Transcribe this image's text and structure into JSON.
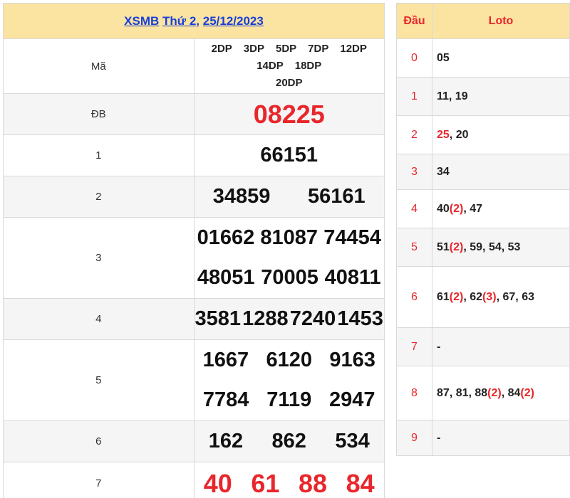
{
  "header": {
    "brand": "XSMB",
    "day": "Thứ 2",
    "separator": ",",
    "date": "25/12/2023"
  },
  "ma": {
    "label": "Mã",
    "codes": [
      "2DP",
      "3DP",
      "5DP",
      "7DP",
      "12DP",
      "14DP",
      "18DP",
      "20DP"
    ]
  },
  "prizes": [
    {
      "label": "ĐB",
      "numbers": [
        "08225"
      ]
    },
    {
      "label": "1",
      "numbers": [
        "66151"
      ]
    },
    {
      "label": "2",
      "numbers": [
        "34859",
        "56161"
      ]
    },
    {
      "label": "3",
      "numbers": [
        "01662",
        "81087",
        "74454",
        "48051",
        "70005",
        "40811"
      ]
    },
    {
      "label": "4",
      "numbers": [
        "3581",
        "1288",
        "7240",
        "1453"
      ]
    },
    {
      "label": "5",
      "numbers": [
        "1667",
        "6120",
        "9163",
        "7784",
        "7119",
        "2947"
      ]
    },
    {
      "label": "6",
      "numbers": [
        "162",
        "862",
        "534"
      ]
    },
    {
      "label": "7",
      "numbers": [
        "40",
        "61",
        "88",
        "84"
      ]
    }
  ],
  "loto": {
    "col_dau": "Đầu",
    "col_loto": "Loto",
    "rows": [
      {
        "dau": "0",
        "parts": [
          [
            "05",
            false
          ]
        ]
      },
      {
        "dau": "1",
        "parts": [
          [
            "11, 19",
            false
          ]
        ]
      },
      {
        "dau": "2",
        "parts": [
          [
            "25",
            true
          ],
          [
            ", 20",
            false
          ]
        ]
      },
      {
        "dau": "3",
        "parts": [
          [
            "34",
            false
          ]
        ]
      },
      {
        "dau": "4",
        "parts": [
          [
            "40",
            false
          ],
          [
            "(2)",
            true
          ],
          [
            ", 47",
            false
          ]
        ]
      },
      {
        "dau": "5",
        "parts": [
          [
            "51",
            false
          ],
          [
            "(2)",
            true
          ],
          [
            ", 59, 54, 53",
            false
          ]
        ]
      },
      {
        "dau": "6",
        "parts": [
          [
            "61",
            false
          ],
          [
            "(2)",
            true
          ],
          [
            ", 62",
            false
          ],
          [
            "(3)",
            true
          ],
          [
            ", 67, 63",
            false
          ]
        ]
      },
      {
        "dau": "7",
        "parts": [
          [
            "-",
            false
          ]
        ]
      },
      {
        "dau": "8",
        "parts": [
          [
            "87, 81, 88",
            false
          ],
          [
            "(2)",
            true
          ],
          [
            ", 84",
            false
          ],
          [
            "(2)",
            true
          ]
        ]
      },
      {
        "dau": "9",
        "parts": [
          [
            "-",
            false
          ]
        ]
      }
    ]
  },
  "colors": {
    "header_bg": "#fbe3a1",
    "link": "#1a3fd8",
    "highlight_red": "#e8262b",
    "alt_row": "#f5f5f5"
  }
}
